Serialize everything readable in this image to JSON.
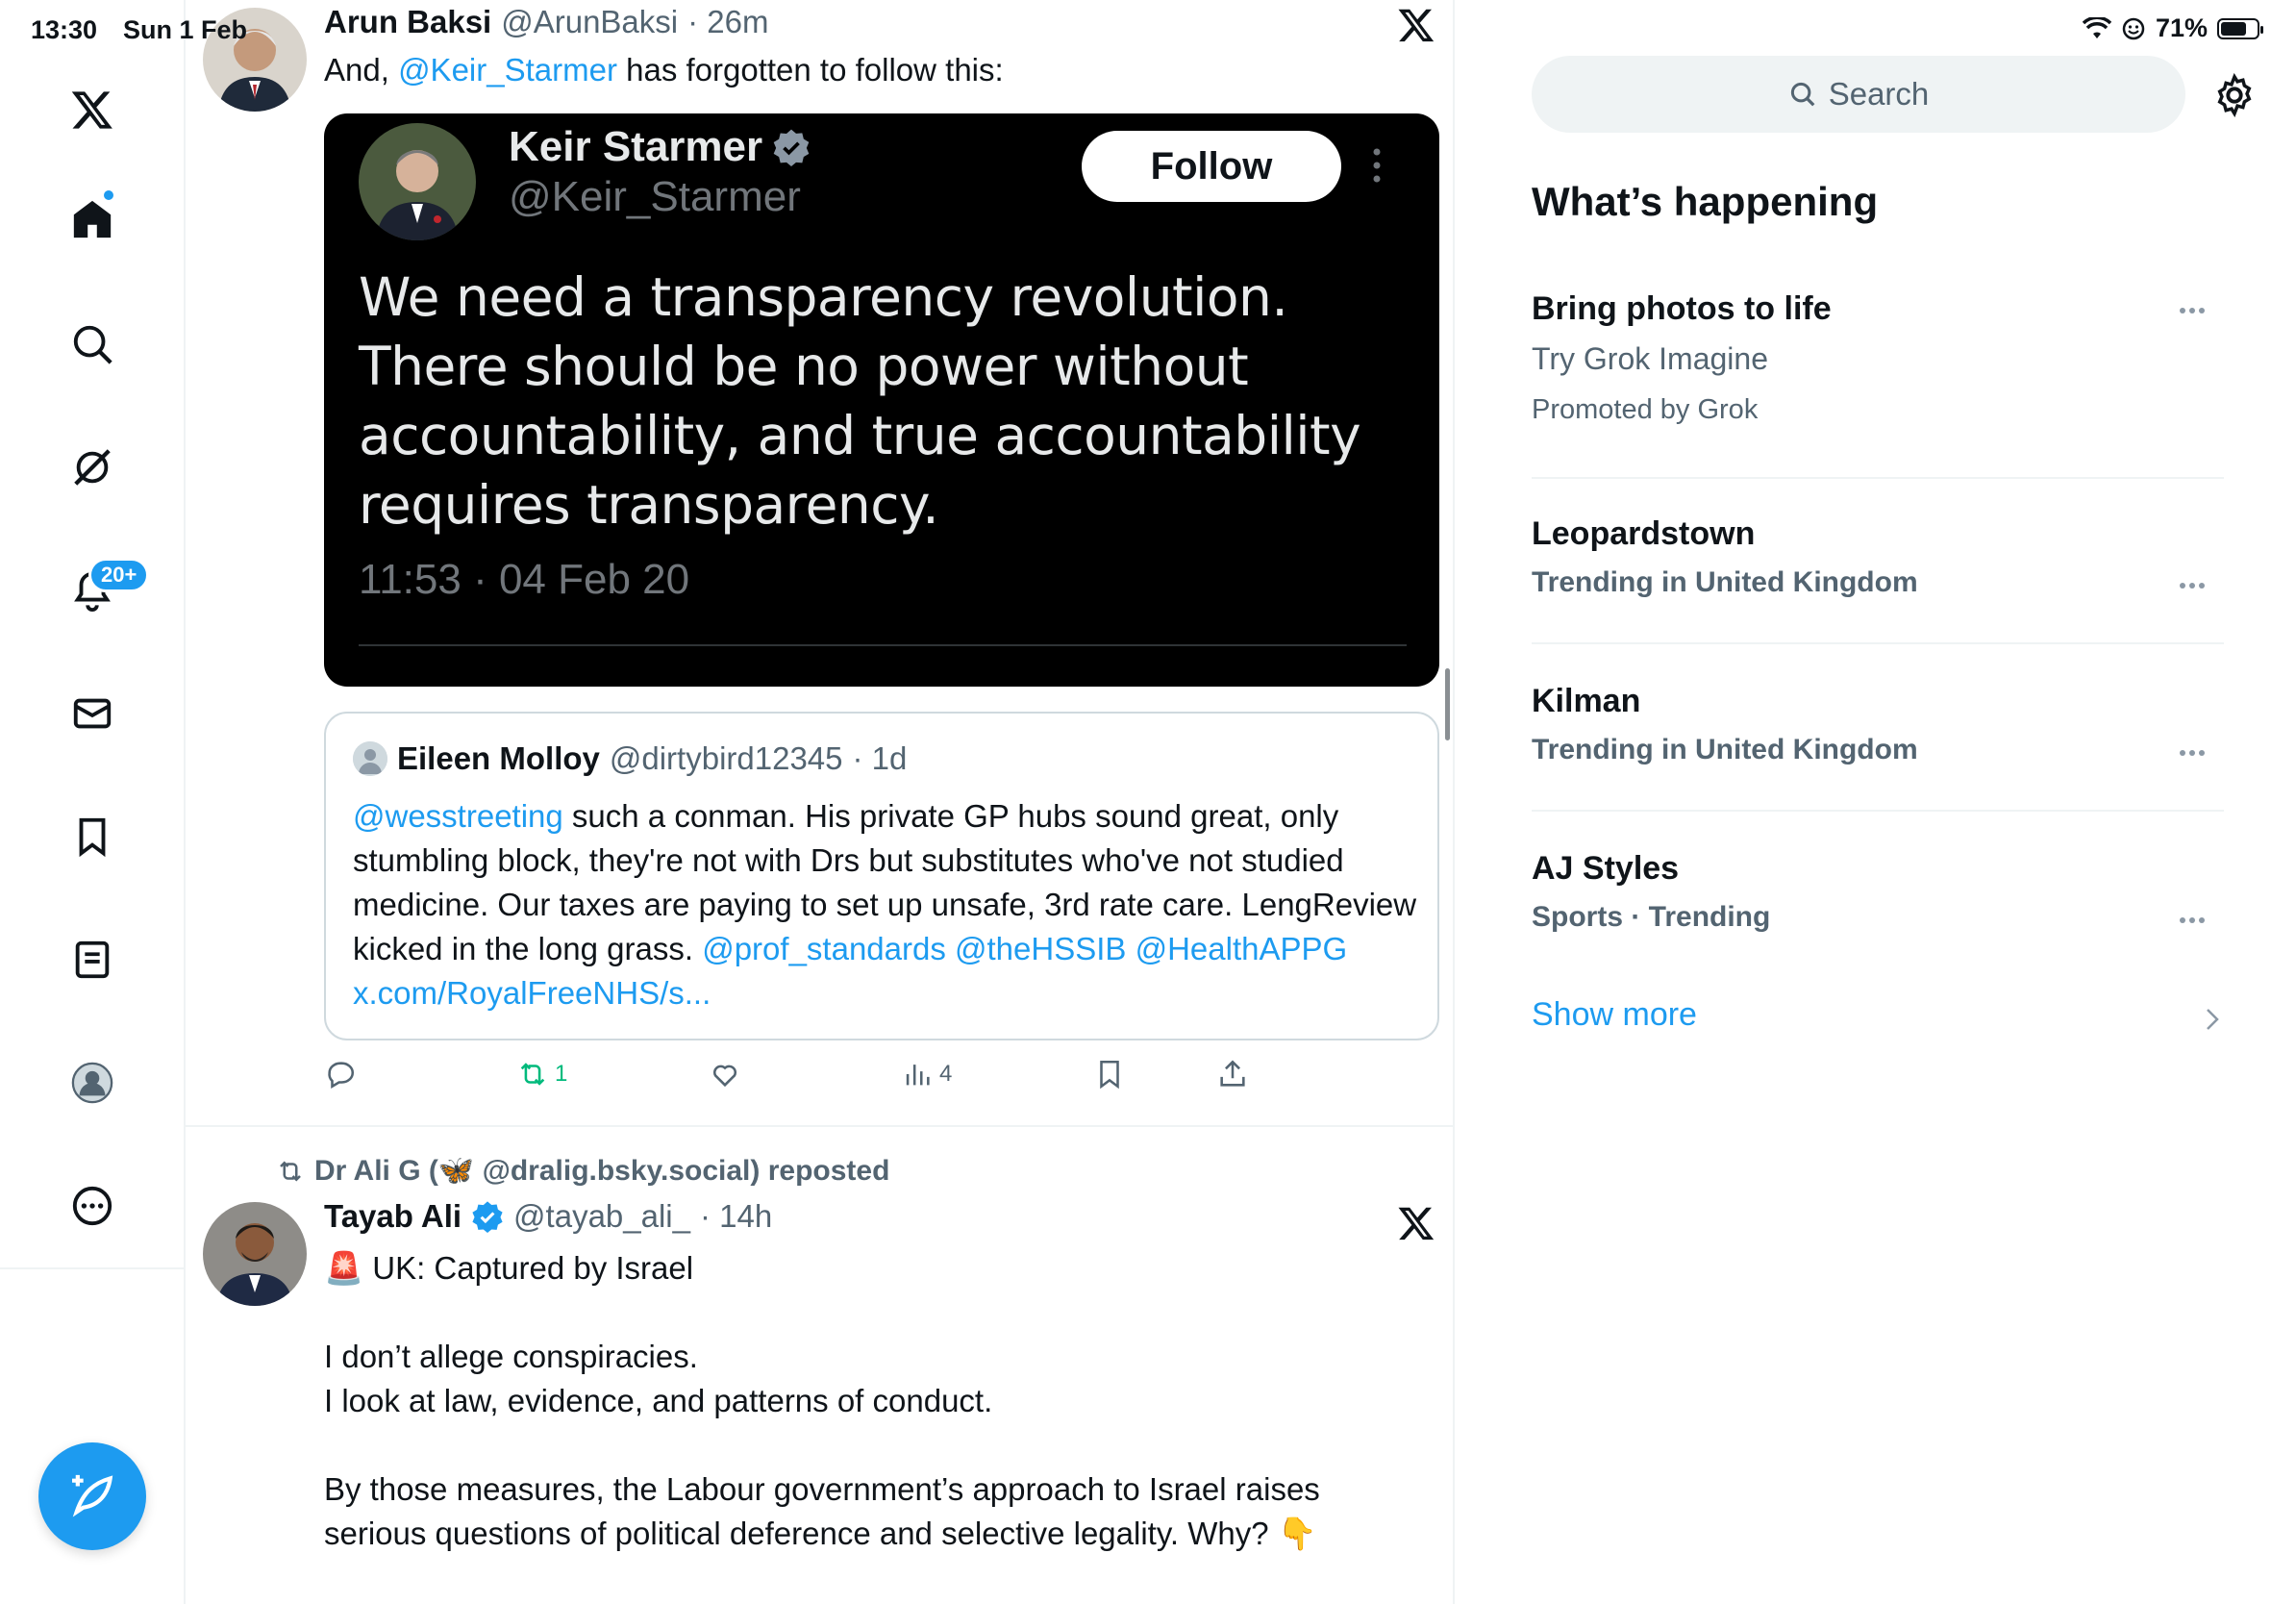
{
  "status_bar": {
    "time": "13:30",
    "date": "Sun 1 Feb",
    "battery": "71%",
    "battery_level": 0.71
  },
  "nav": {
    "items": [
      "x-logo",
      "home",
      "explore",
      "grok",
      "notifications",
      "messages",
      "bookmarks",
      "lists",
      "profile",
      "more"
    ],
    "notifications_badge": "20+"
  },
  "tweet1": {
    "name": "Arun Baksi",
    "handle": "@ArunBaksi",
    "time": "· 26m",
    "text_prefix": "And, ",
    "text_mention": "@Keir_Starmer",
    "text_suffix": " has forgotten to follow this:",
    "screenshot": {
      "name": "Keir Starmer",
      "handle": "@Keir_Starmer",
      "follow": "Follow",
      "text": "We need a transparency revolution. There should be no power without accountability, and true accountability requires transparency.",
      "time": "11:53 · 04 Feb 20"
    },
    "quote": {
      "name": "Eileen Molloy",
      "handle": "@dirtybird12345",
      "time": "· 1d",
      "mention1": "@wesstreeting",
      "text": " such a conman. His private GP hubs sound great, only stumbling block, they're not with Drs but substitutes who've not studied medicine. Our taxes are paying to set up unsafe, 3rd rate care. LengReview kicked in the long grass. ",
      "mention2": "@prof_standards",
      "mention3": "@theHSSIB",
      "mention4": "@HealthAPPG",
      "link": "x.com/RoyalFreeNHS/s..."
    },
    "actions": {
      "reposts": "1",
      "views": "4"
    }
  },
  "tweet2": {
    "repost_by": "Dr Ali G (🦋 @dralig.bsky.social) reposted",
    "name": "Tayab Ali",
    "handle": "@tayab_ali_",
    "time": "· 14h",
    "line1": "🚨 UK: Captured by Israel",
    "line2": "I don’t allege conspiracies.",
    "line3": "I look at law, evidence, and patterns of conduct.",
    "line4": "By those measures, the Labour government’s approach to Israel raises serious questions of political deference and selective legality. Why? 👇"
  },
  "sidebar": {
    "search_placeholder": "Search",
    "title": "What’s happening",
    "trends": [
      {
        "title": "Bring photos to life",
        "sub": "Try Grok Imagine",
        "extra": "Promoted by Grok"
      },
      {
        "title": "Leopardstown",
        "sub": "Trending in United Kingdom"
      },
      {
        "title": "Kilman",
        "sub": "Trending in United Kingdom"
      },
      {
        "title": "AJ Styles",
        "sub": "Sports · Trending"
      }
    ],
    "show_more": "Show more"
  },
  "colors": {
    "accent": "#1d9bf0",
    "repost_green": "#00ba7c",
    "muted": "#536471"
  }
}
